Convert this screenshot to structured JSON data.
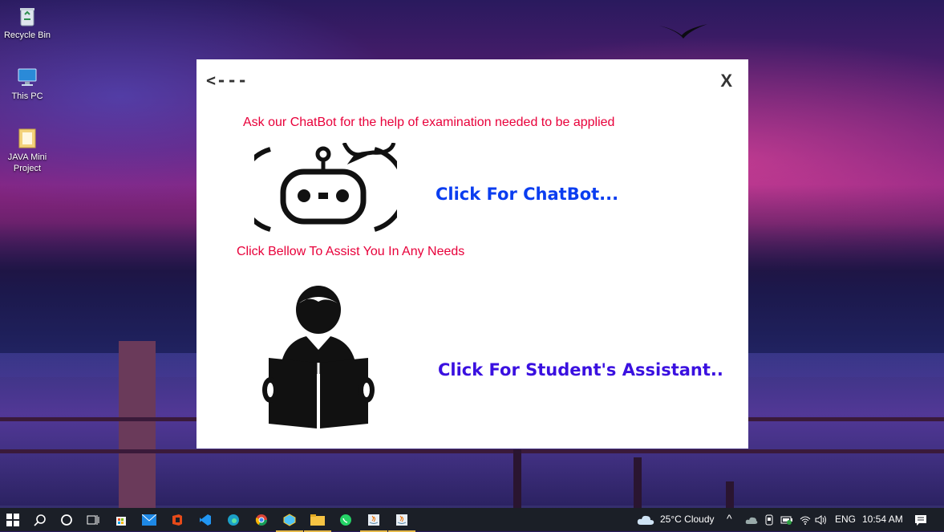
{
  "desktop": {
    "icons": [
      {
        "label": "Recycle Bin"
      },
      {
        "label": "This PC"
      },
      {
        "label": "JAVA Mini Project"
      }
    ]
  },
  "dialog": {
    "back_label": "<---",
    "close_label": "X",
    "chatbot_prompt": "Ask our ChatBot for the help of examination needed to be applied",
    "chatbot_link": "Click For ChatBot...",
    "assist_prompt": "Click Bellow To Assist You In Any Needs",
    "student_link": "Click For Student's Assistant..",
    "colors": {
      "prompt": "#e8003a",
      "chatbot_link": "#0a3df0",
      "student_link": "#3a10e0"
    }
  },
  "taskbar": {
    "weather": "25°C  Cloudy",
    "language": "ENG",
    "time": "10:54 AM",
    "apps": [
      "start-icon",
      "search-icon",
      "cortana-icon",
      "task-view-icon",
      "store-icon",
      "mail-icon",
      "office-icon",
      "vscode-icon",
      "edge-icon",
      "chrome-icon",
      "app-icon",
      "file-explorer-icon",
      "whatsapp-icon",
      "java-app-icon",
      "java-app-icon-2"
    ]
  }
}
